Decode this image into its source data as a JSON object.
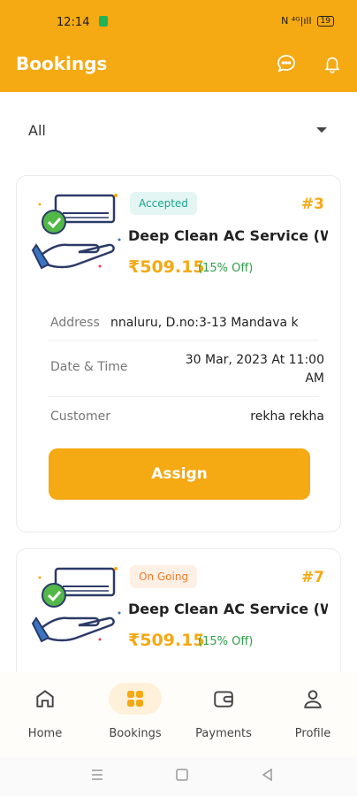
{
  "status_bar": {
    "time": "12:14",
    "signal_text": "N ⁴ᴳ|ıll",
    "battery": "19"
  },
  "header": {
    "title": "Bookings",
    "chat_icon": "chat-bubble-icon",
    "bell_icon": "bell-icon"
  },
  "filter": {
    "selected": "All"
  },
  "bookings": [
    {
      "status": "Accepted",
      "order_no": "#3",
      "service": "Deep Clean AC Service (W",
      "price": "₹509.15",
      "discount": "(15% Off)",
      "address_label": "Address",
      "address_value": "nnaluru, D.no:3-13 Mandava k",
      "datetime_label": "Date & Time",
      "datetime_value": "30 Mar, 2023 At 11:00 AM",
      "customer_label": "Customer",
      "customer_value": "rekha rekha",
      "action_label": "Assign"
    },
    {
      "status": "On Going",
      "order_no": "#7",
      "service": "Deep Clean AC Service (W",
      "price": "₹509.15",
      "discount": "(15% Off)"
    }
  ],
  "bottom_nav": [
    {
      "label": "Home",
      "icon": "home-icon"
    },
    {
      "label": "Bookings",
      "icon": "bookings-icon",
      "active": true
    },
    {
      "label": "Payments",
      "icon": "wallet-icon"
    },
    {
      "label": "Profile",
      "icon": "profile-icon"
    }
  ],
  "colors": {
    "accent": "#F5A912",
    "accepted": "#1aa38f",
    "ongoing": "#f47c27",
    "discount": "#2e9d47"
  }
}
